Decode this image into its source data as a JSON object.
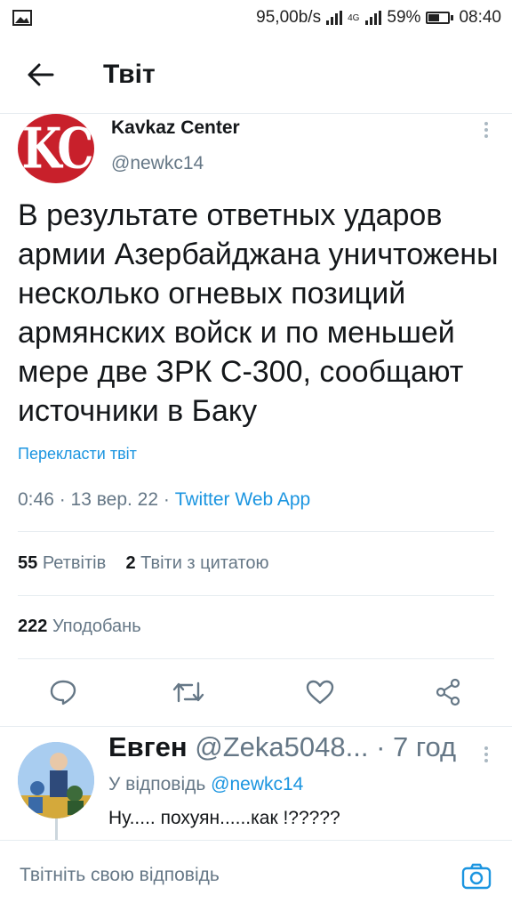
{
  "status_bar": {
    "speed": "95,00b/s",
    "network": "4G",
    "battery": "59%",
    "battery_level": 0.59,
    "time": "08:40"
  },
  "header": {
    "title": "Твіт"
  },
  "tweet": {
    "avatar_text": "KC",
    "author_name": "Kavkaz Center",
    "author_handle": "@newkc14",
    "text": "В результате ответных ударов армии Азербайджана уничтожены несколько огневых позиций армянских войск и по меньшей мере две ЗРК С-300, сообщают источники в Баку",
    "translate_label": "Перекласти твіт",
    "meta_time": "0:46 · 13 вер. 22 · ",
    "meta_app": "Twitter Web App",
    "retweets_count": "55",
    "retweets_label": "Ретвітів",
    "quotes_count": "2",
    "quotes_label": "Твіти з цитатою",
    "likes_count": "222",
    "likes_label": "Уподобань",
    "icons": [
      "reply-icon",
      "retweet-icon",
      "like-icon",
      "share-icon"
    ]
  },
  "reply": {
    "author_name": "Евген",
    "author_handle": "@Zeka5048...",
    "time": "· 7 год",
    "replying_prefix": "У відповідь ",
    "replying_handle": "@newkc14",
    "text": "Ну..... похуян......как !?????"
  },
  "compose": {
    "placeholder": "Твітніть свою відповідь"
  },
  "colors": {
    "accent": "#1b95e0",
    "secondary_text": "#657786",
    "avatar_red": "#c8202b"
  }
}
